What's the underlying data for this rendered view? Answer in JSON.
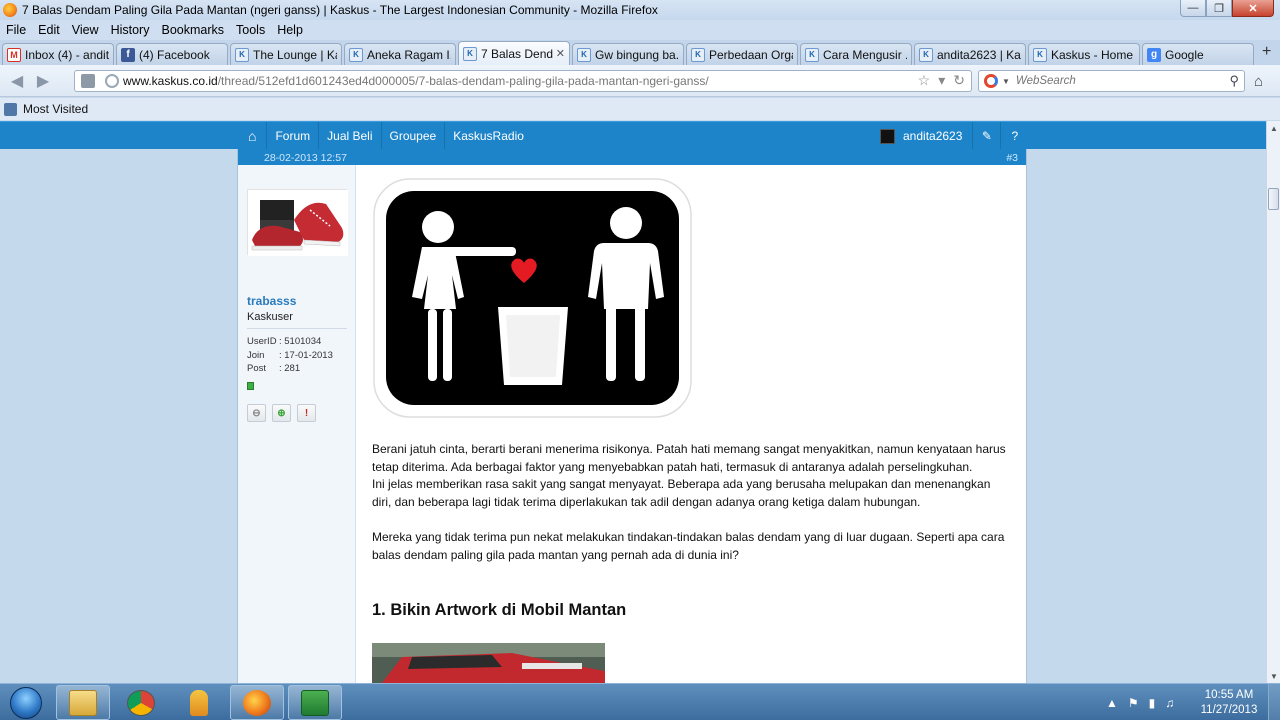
{
  "window": {
    "title": "7 Balas Dendam Paling Gila Pada Mantan (ngeri ganss) | Kaskus - The Largest Indonesian Community - Mozilla Firefox",
    "min": "—",
    "max": "❐",
    "close": "✕"
  },
  "menu": [
    "File",
    "Edit",
    "View",
    "History",
    "Bookmarks",
    "Tools",
    "Help"
  ],
  "tabs": [
    {
      "label": "Inbox (4) - andit...",
      "icon": "gmail-icon",
      "fav": "M"
    },
    {
      "label": "(4) Facebook",
      "icon": "facebook-icon",
      "fav": "f"
    },
    {
      "label": "The Lounge | Ka...",
      "icon": "kaskus-icon",
      "fav": "K"
    },
    {
      "label": "Aneka Ragam I...",
      "icon": "kaskus-icon",
      "fav": "K"
    },
    {
      "label": "7 Balas Dend...",
      "icon": "kaskus-icon",
      "fav": "K",
      "active": true,
      "close": "✕"
    },
    {
      "label": "Gw bingung ba...",
      "icon": "kaskus-icon",
      "fav": "K"
    },
    {
      "label": "Perbedaan Orga...",
      "icon": "kaskus-icon",
      "fav": "K"
    },
    {
      "label": "Cara Mengusir ...",
      "icon": "kaskus-icon",
      "fav": "K"
    },
    {
      "label": "andita2623 | Kas...",
      "icon": "kaskus-icon",
      "fav": "K"
    },
    {
      "label": "Kaskus - Home ...",
      "icon": "kaskus-icon",
      "fav": "K"
    },
    {
      "label": "Google",
      "icon": "google-icon",
      "fav": "g"
    }
  ],
  "newtab": "+",
  "nav": {
    "back": "◀",
    "forward": "▶",
    "url_domain": "www.kaskus.co.id",
    "url_path": "/thread/512efd1d601243ed4d000005/7-balas-dendam-paling-gila-pada-mantan-ngeri-ganss/",
    "star": "☆",
    "dropdown": "▾",
    "reload": "↻",
    "search_placeholder": "WebSearch",
    "search_caret": "▼",
    "magnifier": "⚲",
    "home": "⌂"
  },
  "bookmarks": {
    "most_visited": "Most Visited"
  },
  "kaskus_nav": {
    "home": "⌂",
    "items": [
      "Forum",
      "Jual Beli",
      "Groupee",
      "KaskusRadio"
    ],
    "username": "andita2623",
    "edit": "✎",
    "help": "?"
  },
  "post": {
    "date": "28-02-2013 12:57",
    "number": "#3",
    "user": {
      "name": "trabasss",
      "rank": "Kaskuser",
      "stats": [
        {
          "k": "UserID",
          "v": ": 5101034"
        },
        {
          "k": "Join",
          "v": ": 17-01-2013"
        },
        {
          "k": "Post",
          "v": ": 281"
        }
      ],
      "actions": [
        "⊖",
        "⊕",
        "!"
      ]
    },
    "paragraphs": [
      "Berani jatuh cinta, berarti berani menerima risikonya. Patah hati memang sangat menyakitkan, namun kenyataan harus tetap diterima. Ada berbagai faktor yang menyebabkan patah hati, termasuk di antaranya adalah perselingkuhan.",
      "Ini jelas memberikan rasa sakit yang sangat menyayat. Beberapa ada yang berusaha melupakan dan menenangkan diri, dan beberapa lagi tidak terima diperlakukan tak adil dengan adanya orang ketiga dalam hubungan.",
      "Mereka yang tidak terima pun nekat melakukan tindakan-tindakan balas dendam yang di luar dugaan. Seperti apa cara balas dendam paling gila pada mantan yang pernah ada di dunia ini?"
    ],
    "heading": "1. Bikin Artwork di Mobil Mantan"
  },
  "scroll": {
    "up": "▲",
    "down": "▼"
  },
  "taskbar": {
    "tray_icons": [
      "▲",
      "⚑",
      "▮",
      "♫"
    ],
    "time": "10:55 AM",
    "date": "11/27/2013"
  }
}
